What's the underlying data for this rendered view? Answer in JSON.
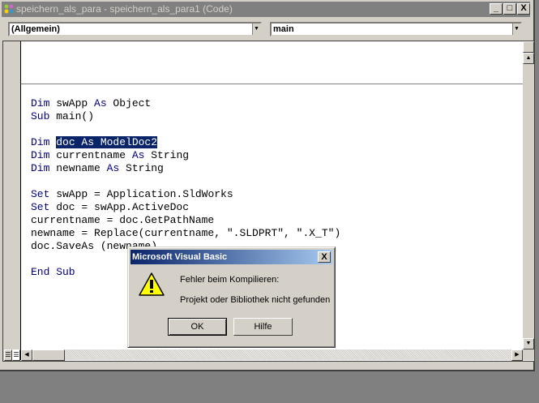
{
  "window": {
    "title": "speichern_als_para - speichern_als_para1 (Code)",
    "min": "_",
    "max": "□",
    "close": "X"
  },
  "object_combo": {
    "value": "(Allgemein)"
  },
  "proc_combo": {
    "value": "main"
  },
  "code": {
    "lines": [
      [],
      [],
      [
        {
          "k": "kw",
          "t": "Dim"
        },
        {
          "t": " swApp "
        },
        {
          "k": "kw",
          "t": "As"
        },
        {
          "t": " Object"
        }
      ],
      [
        {
          "k": "kw",
          "t": "Sub"
        },
        {
          "t": " main()"
        }
      ],
      [],
      [
        {
          "k": "kw",
          "t": "Dim"
        },
        {
          "t": " "
        },
        {
          "k": "sel",
          "t": "doc As ModelDoc2"
        }
      ],
      [
        {
          "k": "kw",
          "t": "Dim"
        },
        {
          "t": " currentname "
        },
        {
          "k": "kw",
          "t": "As"
        },
        {
          "t": " String"
        }
      ],
      [
        {
          "k": "kw",
          "t": "Dim"
        },
        {
          "t": " newname "
        },
        {
          "k": "kw",
          "t": "As"
        },
        {
          "t": " String"
        }
      ],
      [],
      [
        {
          "k": "kw",
          "t": "Set"
        },
        {
          "t": " swApp = Application.SldWorks"
        }
      ],
      [
        {
          "k": "kw",
          "t": "Set"
        },
        {
          "t": " doc = swApp.ActiveDoc"
        }
      ],
      [
        {
          "t": "currentname = doc.GetPathName"
        }
      ],
      [
        {
          "t": "newname = Replace(currentname, \".SLDPRT\", \".X_T\")"
        }
      ],
      [
        {
          "t": "doc.SaveAs (newname)"
        }
      ],
      [],
      [
        {
          "k": "kw",
          "t": "End Sub"
        }
      ]
    ]
  },
  "dialog": {
    "title": "Microsoft Visual Basic",
    "close": "X",
    "message1": "Fehler beim Kompilieren:",
    "message2": "Projekt oder Bibliothek nicht gefunden",
    "ok": "OK",
    "help": "Hilfe",
    "icon": "warning-icon"
  }
}
